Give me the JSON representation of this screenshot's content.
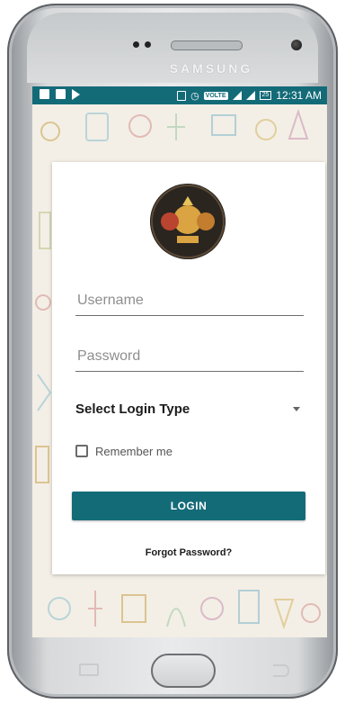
{
  "device": {
    "brand": "SAMSUNG"
  },
  "status_bar": {
    "time": "12:31 AM",
    "battery": "25",
    "network_tag": "VOLTE"
  },
  "login": {
    "username_placeholder": "Username",
    "password_placeholder": "Password",
    "select_login_type": "Select Login Type",
    "remember_me": "Remember me",
    "login_button": "LOGIN",
    "forgot_password": "Forgot Password?"
  },
  "colors": {
    "accent": "#146b78",
    "screen_background": "#f3efe6"
  },
  "icons": {
    "status_left": [
      "image-icon",
      "image-icon",
      "play-icon"
    ],
    "status_right": [
      "vibrate-icon",
      "alarm-icon",
      "volte-icon",
      "signal-icon",
      "battery-icon"
    ],
    "select_caret": "chevron-down-icon"
  }
}
